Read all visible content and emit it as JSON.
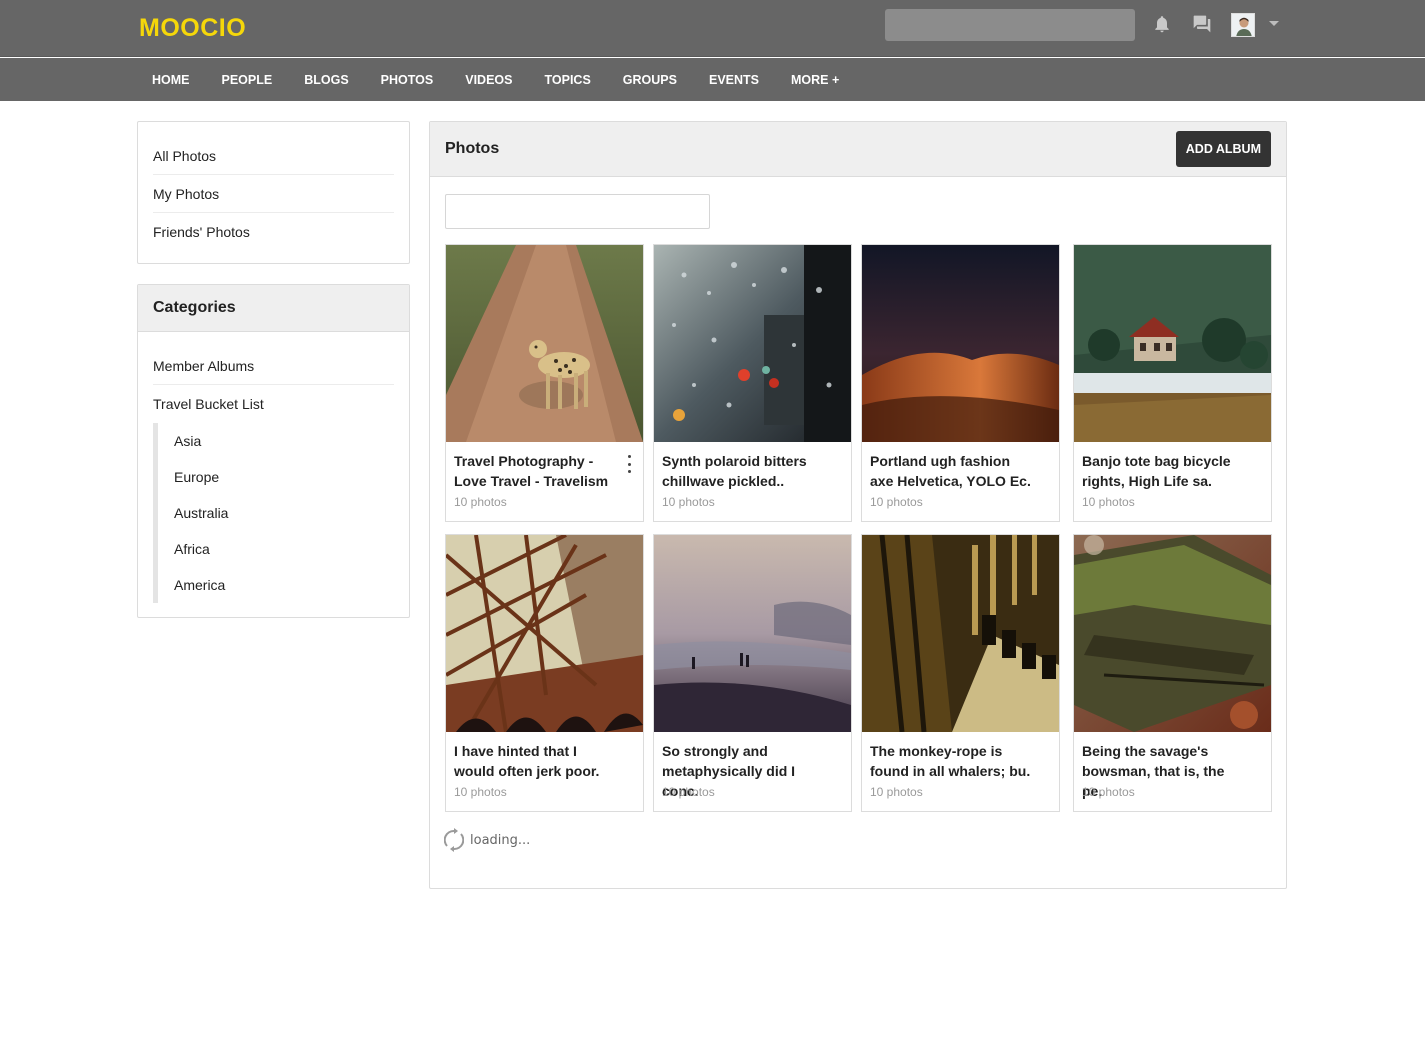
{
  "header": {
    "logo": "MOOCIO",
    "search_placeholder": "",
    "icons": [
      "bell-icon",
      "chat-icon"
    ],
    "avatar": "avatar"
  },
  "nav": {
    "items": [
      "HOME",
      "PEOPLE",
      "BLOGS",
      "PHOTOS",
      "VIDEOS",
      "TOPICS",
      "GROUPS",
      "EVENTS",
      "MORE +"
    ]
  },
  "sidebar": {
    "menu": [
      "All Photos",
      "My Photos",
      "Friends' Photos"
    ],
    "categories_title": "Categories",
    "categories": [
      "Member Albums",
      "Travel Bucket List"
    ],
    "subcategories": [
      "Asia",
      "Europe",
      "Australia",
      "Africa",
      "America"
    ]
  },
  "main": {
    "title": "Photos",
    "add_button": "ADD ALBUM",
    "filter_placeholder": "",
    "albums": [
      {
        "title": "Travel Photography - Love Travel - Travelism",
        "count": "10 photos",
        "image": "leopard on dirt road"
      },
      {
        "title": "Synth polaroid bitters chillwave pickled..",
        "count": "10 photos",
        "image": "rain drops on window"
      },
      {
        "title": "Portland ugh fashion axe Helvetica, YOLO Ec.",
        "count": "10 photos",
        "image": "desert dunes at night"
      },
      {
        "title": "Banjo tote bag bicycle rights, High Life sa.",
        "count": "10 photos",
        "image": "lake house in forest"
      },
      {
        "title": "I have hinted that I would often jerk poor.",
        "count": "10 photos",
        "image": "steel bridge structure"
      },
      {
        "title": "So strongly and metaphysically did I conc.",
        "count": "10 photos",
        "image": "misty beach"
      },
      {
        "title": "The monkey-rope is found in all whalers; bu.",
        "count": "10 photos",
        "image": "wooden corridor"
      },
      {
        "title": "Being the savage's bowsman, that is, the pe.",
        "count": "10 photos",
        "image": "mossy log"
      }
    ],
    "loading": "loading..."
  },
  "colors": {
    "header_bg": "#666666",
    "logo": "#f5d70a",
    "button_bg": "#333333"
  }
}
